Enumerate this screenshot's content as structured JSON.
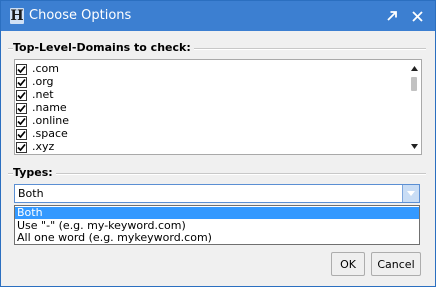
{
  "window": {
    "title": "Choose Options",
    "app_icon_glyph": "H",
    "titlebar_color": "#3c7fd1"
  },
  "tld_group": {
    "label": "Top-Level-Domains to check:",
    "items": [
      {
        "label": ".com",
        "checked": true
      },
      {
        "label": ".org",
        "checked": true
      },
      {
        "label": ".net",
        "checked": true
      },
      {
        "label": ".name",
        "checked": true
      },
      {
        "label": ".online",
        "checked": true
      },
      {
        "label": ".space",
        "checked": true
      },
      {
        "label": ".xyz",
        "checked": true
      }
    ]
  },
  "types_group": {
    "label": "Types:",
    "selected": "Both",
    "options": [
      "Both",
      "Use \"-\" (e.g. my-keyword.com)",
      "All one word (e.g. mykeyword.com)"
    ]
  },
  "buttons": {
    "ok_label": "OK",
    "cancel_label": "Cancel"
  },
  "colors": {
    "selection": "#3399ff",
    "combo_border": "#5b8fd3"
  }
}
